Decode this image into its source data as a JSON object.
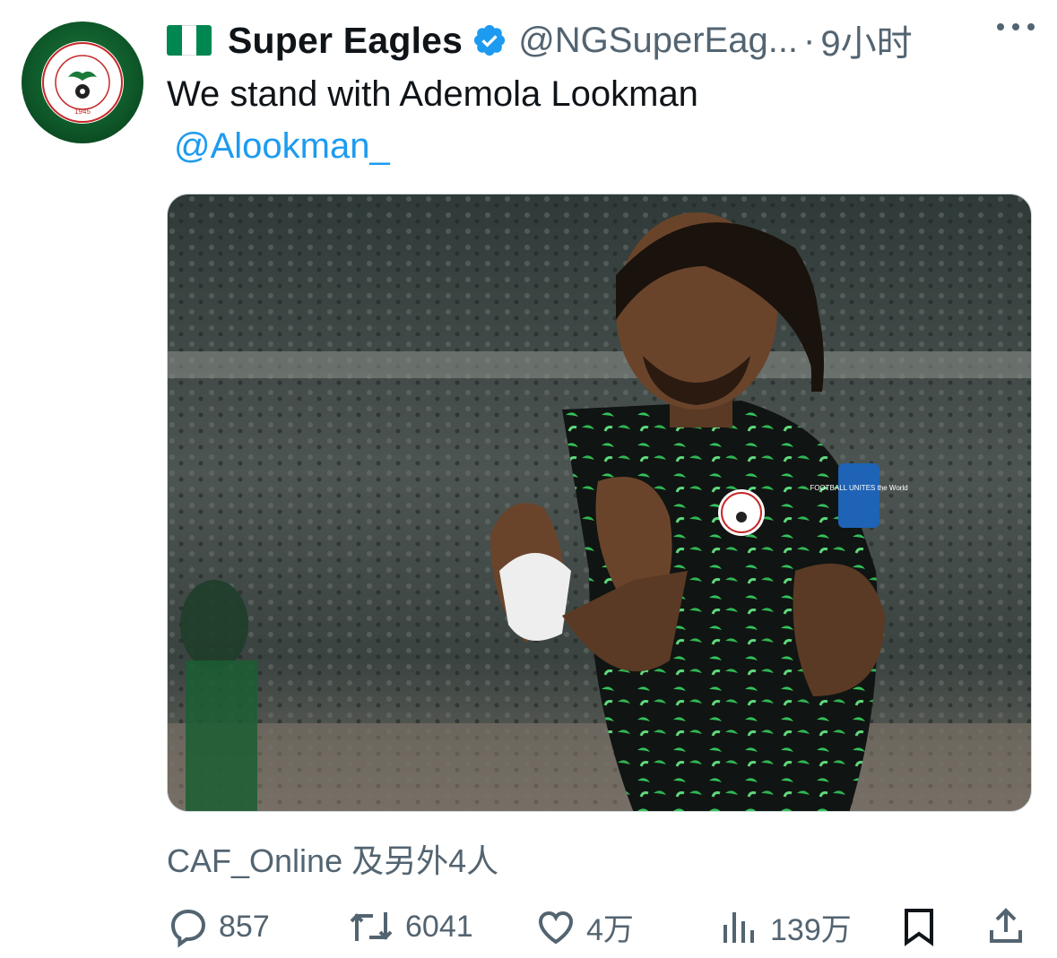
{
  "tweet": {
    "display_name": "Super Eagles",
    "handle": "@NGSuperEag...",
    "separator": "·",
    "time": "9小时",
    "text": "We stand with Ademola Lookman",
    "mention": "@Alookman_",
    "tagged": "CAF_Online 及另外4人",
    "avatar_text_top": "NIGERIA FOOTBALL FEDERATION",
    "avatar_year": "1945",
    "flag_colors": [
      "#008751",
      "#ffffff",
      "#008751"
    ]
  },
  "media": {
    "jersey_badge_text": "FOOTBALL UNITES the World"
  },
  "actions": {
    "replies": "857",
    "reposts": "6041",
    "likes": "4万",
    "views": "139万"
  },
  "colors": {
    "accent": "#1d9bf0",
    "secondary_text": "#536471",
    "verified": "#1d9bf0"
  }
}
